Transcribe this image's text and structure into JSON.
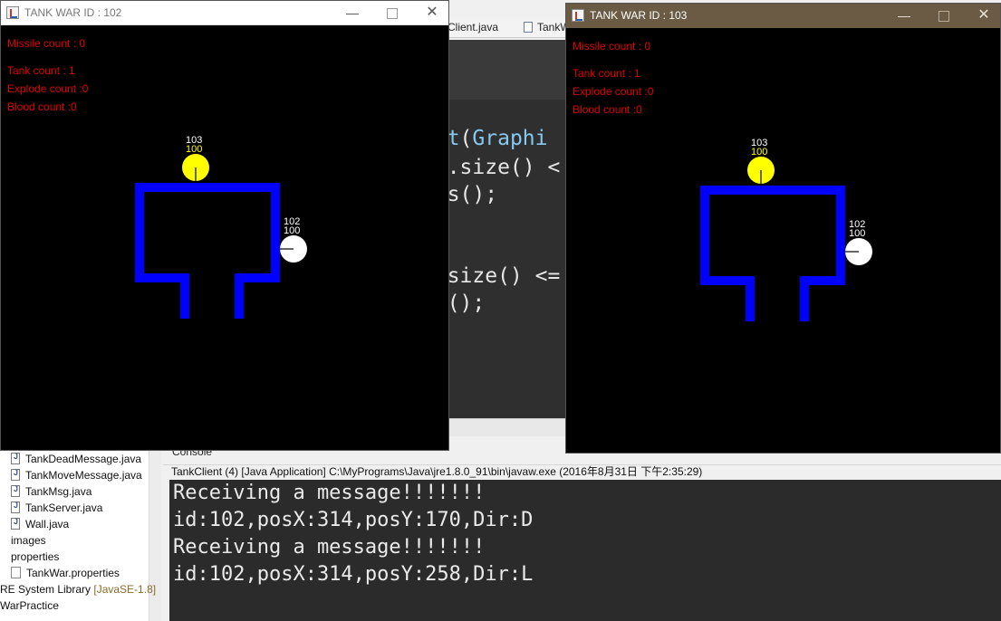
{
  "ide": {
    "tabs": [
      {
        "label": "Client.java"
      },
      {
        "label": "TankW"
      }
    ],
    "code_lines": [
      {
        "pre": "",
        "kw": "int",
        "mid": "(",
        "kw2": "Graphi",
        "post": ""
      },
      {
        "text": "ls.size() <"
      },
      {
        "text": "ods();"
      },
      {
        "text": "s.size() <="
      },
      {
        "text": "ks();"
      },
      {
        "text": ");"
      }
    ]
  },
  "package_explorer": {
    "items": [
      {
        "label": "TankDeadMessage.java",
        "type": "java"
      },
      {
        "label": "TankMoveMessage.java",
        "type": "java"
      },
      {
        "label": "TankMsg.java",
        "type": "java"
      },
      {
        "label": "TankServer.java",
        "type": "java"
      },
      {
        "label": "Wall.java",
        "type": "java"
      },
      {
        "label": "images",
        "type": "folder"
      },
      {
        "label": "properties",
        "type": "folder"
      },
      {
        "label": "TankWar.properties",
        "type": "file"
      },
      {
        "label": "RE System Library",
        "suffix": "[JavaSE-1.8]",
        "type": "library"
      },
      {
        "label": "WarPractice",
        "type": "project"
      }
    ]
  },
  "console": {
    "tab_label": "Console",
    "description": "TankClient (4) [Java Application] C:\\MyPrograms\\Java\\jre1.8.0_91\\bin\\javaw.exe (2016年8月31日 下午2:35:29)",
    "lines": [
      "Receiving a message!!!!!!!",
      "id:102,posX:314,posY:170,Dir:D",
      "Receiving a message!!!!!!!",
      "id:102,posX:314,posY:258,Dir:L"
    ]
  },
  "windows": [
    {
      "title": "TANK WAR ID : 102",
      "stats": {
        "missile": "Missile count : 0",
        "tank": "Tank count : 1",
        "explode": "Explode count :0",
        "blood": "Blood count :0"
      },
      "tanks": [
        {
          "id": "103",
          "hp": "100",
          "color": "#ffff00"
        },
        {
          "id": "102",
          "hp": "100",
          "color": "#ffffff"
        }
      ]
    },
    {
      "title": "TANK WAR ID : 103",
      "stats": {
        "missile": "Missile count : 0",
        "tank": "Tank count : 1",
        "explode": "Explode count :0",
        "blood": "Blood count :0"
      },
      "tanks": [
        {
          "id": "103",
          "hp": "100",
          "color": "#ffff00"
        },
        {
          "id": "102",
          "hp": "100",
          "color": "#ffffff"
        }
      ]
    }
  ],
  "colors": {
    "wall": "#0000ff",
    "stat_text": "#e00000",
    "console_bg": "#2b2b2b"
  },
  "icons": {
    "window_app": "java-app-icon",
    "minimize": "minimize-icon",
    "maximize": "maximize-icon",
    "close": "close-icon"
  }
}
